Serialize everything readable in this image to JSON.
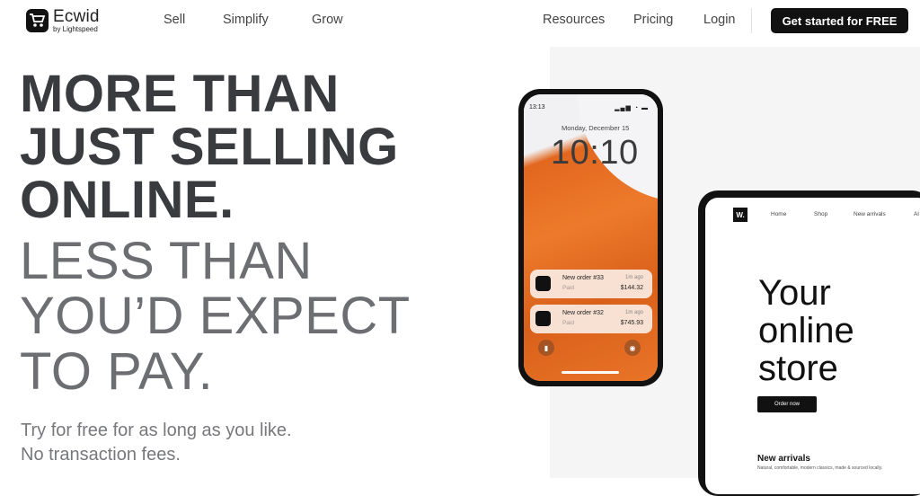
{
  "header": {
    "logo_name": "Ecwid",
    "logo_sub": "by Lightspeed",
    "nav_left": [
      "Sell",
      "Simplify",
      "Grow"
    ],
    "nav_right": [
      "Resources",
      "Pricing",
      "Login"
    ],
    "cta_label": "Get started for FREE"
  },
  "hero": {
    "bold_lines": [
      "MORE THAN",
      "JUST SELLING",
      "ONLINE."
    ],
    "light_lines": [
      "LESS THAN",
      "YOU’D EXPECT",
      "TO PAY."
    ],
    "sub_lines": [
      "Try for free for as long as you like.",
      "No transaction fees."
    ]
  },
  "phone": {
    "status_time": "13:13",
    "status_icons": "▂▄▆ ◔ ▬",
    "date": "Monday, December 15",
    "time": "10:10",
    "notifications": [
      {
        "title": "New order #33",
        "status": "Paid",
        "ago": "1m ago",
        "price": "$144.32"
      },
      {
        "title": "New order #32",
        "status": "Paid",
        "ago": "1m ago",
        "price": "$745.93"
      }
    ]
  },
  "tablet": {
    "logo": "W.",
    "nav": [
      "Home",
      "Shop",
      "New arrivals",
      "Al"
    ],
    "hero_lines": [
      "Your",
      "online",
      "store"
    ],
    "button": "Order now",
    "section_title": "New arrivals",
    "section_sub": "Natural, comfortable, modern classics, made & sourced locally."
  },
  "colors": {
    "cta_bg": "#111111",
    "orange": "#e97428",
    "heading": "#3a3b3f"
  }
}
